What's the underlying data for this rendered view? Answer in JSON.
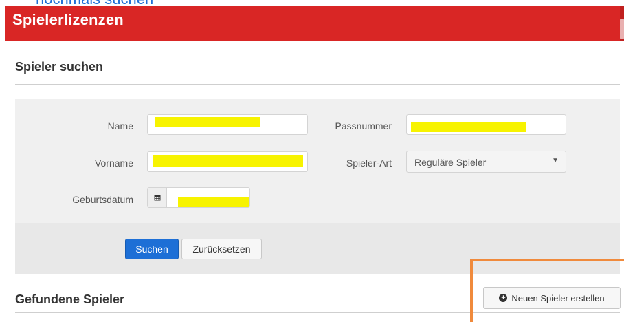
{
  "annotations": {
    "top_note": "nochmals suchen",
    "highlight_color": "#f08a3c"
  },
  "header": {
    "title": "Spielerlizenzen",
    "color": "#d92625"
  },
  "search": {
    "title": "Spieler suchen",
    "fields": {
      "name_label": "Name",
      "passnummer_label": "Passnummer",
      "vorname_label": "Vorname",
      "spielerart_label": "Spieler-Art",
      "spielerart_value": "Reguläre Spieler",
      "geburtsdatum_label": "Geburtsdatum"
    },
    "actions": {
      "search_label": "Suchen",
      "reset_label": "Zurücksetzen"
    }
  },
  "results": {
    "title": "Gefundene Spieler",
    "new_player_label": "Neuen Spieler erstellen"
  },
  "icons": {
    "calendar": "calendar-icon",
    "plus_circle": "plus-circle-icon",
    "caret": "chevron-down-icon"
  }
}
